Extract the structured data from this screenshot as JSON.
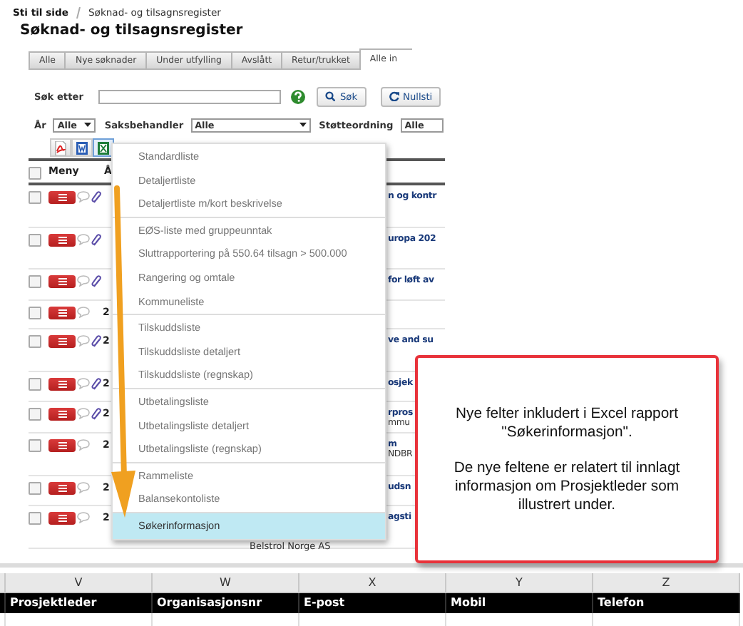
{
  "breadcrumb": {
    "label": "Sti til side",
    "current": "Søknad- og tilsagnsregister"
  },
  "page_title": "Søknad- og tilsagnsregister",
  "tabs": [
    {
      "label": "Alle",
      "selected": false
    },
    {
      "label": "Nye søknader",
      "selected": false
    },
    {
      "label": "Under utfylling",
      "selected": false
    },
    {
      "label": "Avslått",
      "selected": false
    },
    {
      "label": "Retur/trukket",
      "selected": false
    },
    {
      "label": "Alle in",
      "selected": true
    }
  ],
  "search": {
    "label": "Søk etter",
    "search_button": "Søk",
    "reset_button": "Nullsti"
  },
  "filters": [
    {
      "label": "År",
      "value": "Alle",
      "arrow": true
    },
    {
      "label": "Saksbehandler",
      "value": "Alle",
      "arrow": true
    },
    {
      "label": "Støtteordning",
      "value": "Alle",
      "arrow": false
    }
  ],
  "export_buttons": [
    {
      "kind": "pdf",
      "selected": false
    },
    {
      "kind": "word",
      "selected": false
    },
    {
      "kind": "excel",
      "selected": true
    }
  ],
  "table": {
    "header_checked": false,
    "columns": [
      "Meny",
      "Å"
    ],
    "rows": [
      {
        "checked": false,
        "attachment": true,
        "column_3": "n og kontr"
      },
      {
        "checked": false,
        "attachment": true,
        "column_3": "uropa 202"
      },
      {
        "checked": false,
        "attachment": true,
        "column_3": "for løft av"
      },
      {
        "checked": false,
        "attachment": false,
        "column_2": "2"
      },
      {
        "checked": false,
        "attachment": true,
        "column_2": "2",
        "column_3": "ve and su"
      },
      {
        "checked": false,
        "attachment": true,
        "column_2": "2",
        "column_3": "osjek"
      },
      {
        "checked": false,
        "attachment": true,
        "column_2": "2",
        "column_3": "rpros",
        "column_3_sub": "mmu"
      },
      {
        "checked": false,
        "attachment": false,
        "column_2": "2",
        "column_3": "m",
        "column_3_sub": "NDBR"
      },
      {
        "checked": false,
        "attachment": false,
        "column_2": "2",
        "column_3": "udsn"
      },
      {
        "checked": false,
        "attachment": false,
        "column_2": "2",
        "column_3": "agsti",
        "column_2_sub": "Belstrol Norge AS"
      }
    ]
  },
  "export_menu": {
    "groups": [
      [
        {
          "label": "Standardliste",
          "selected": false
        },
        {
          "label": "Detaljertliste",
          "selected": false
        },
        {
          "label": "Detaljertliste m/kort beskrivelse",
          "selected": false
        }
      ],
      [
        {
          "label": "EØS-liste med gruppeunntak",
          "selected": false
        },
        {
          "label": "Sluttrapportering på 550.64 tilsagn > 500.000",
          "selected": false
        },
        {
          "label": "Rangering og omtale",
          "selected": false
        },
        {
          "label": "Kommuneliste",
          "selected": false
        }
      ],
      [
        {
          "label": "Tilskuddsliste",
          "selected": false
        },
        {
          "label": "Tilskuddsliste detaljert",
          "selected": false
        },
        {
          "label": "Tilskuddsliste (regnskap)",
          "selected": false
        }
      ],
      [
        {
          "label": "Utbetalingsliste",
          "selected": false
        },
        {
          "label": "Utbetalingsliste detaljert",
          "selected": false
        },
        {
          "label": "Utbetalingsliste (regnskap)",
          "selected": false
        }
      ],
      [
        {
          "label": "Rammeliste",
          "selected": false
        },
        {
          "label": "Balansekontoliste",
          "selected": false
        }
      ],
      [
        {
          "label": "Søkerinformasjon",
          "selected": true
        }
      ]
    ]
  },
  "callout": {
    "paragraphs": [
      "Nye felter inkludert i Excel rapport \"Søkerinformasjon\".",
      "De nye feltene er relatert til innlagt informasjon om Prosjektleder som illustrert under."
    ]
  },
  "spreadsheet": {
    "column_letters": [
      "V",
      "W",
      "X",
      "Y",
      "Z"
    ],
    "headers": [
      "Prosjektleder",
      "Organisasjonsnr",
      "E-post",
      "Mobil",
      "Telefon"
    ]
  }
}
